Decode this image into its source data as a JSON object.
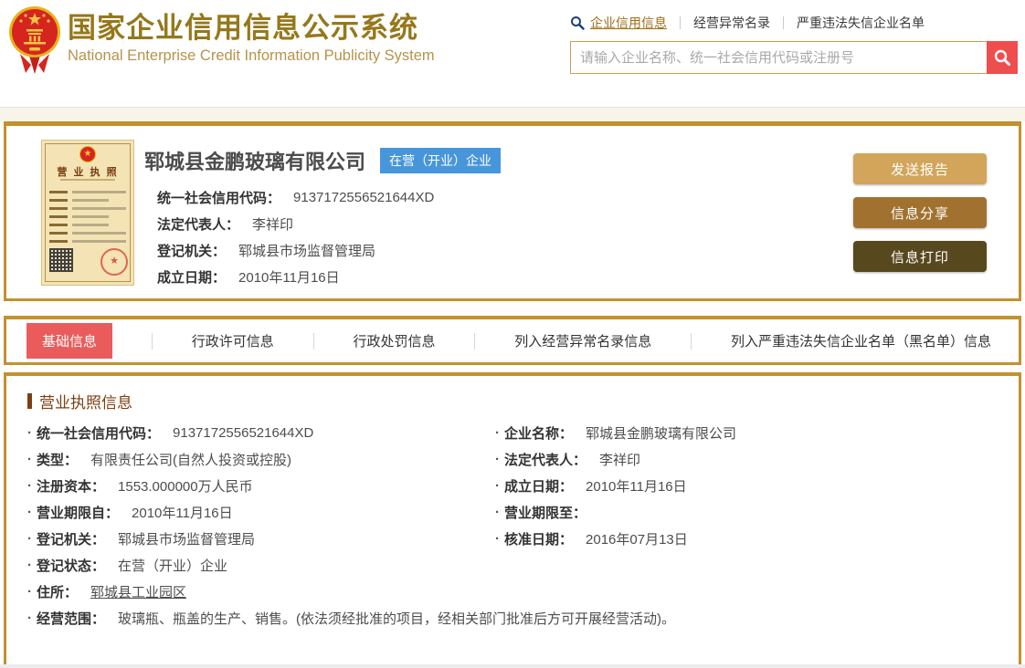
{
  "header": {
    "title_cn": "国家企业信用信息公示系统",
    "title_en": "National Enterprise Credit Information Publicity System",
    "nav": [
      {
        "label": "企业信用信息",
        "active": true
      },
      {
        "label": "经营异常名录",
        "active": false
      },
      {
        "label": "严重违法失信企业名单",
        "active": false
      }
    ],
    "search": {
      "placeholder": "请输入企业名称、统一社会信用代码或注册号",
      "button_icon": "search-icon"
    }
  },
  "company_card": {
    "license_thumbnail_title": "营 业 执 照",
    "name": "郓城县金鹏玻璃有限公司",
    "status_badge": "在营（开业）企业",
    "fields": [
      {
        "label": "统一社会信用代码：",
        "value": "9137172556521644XD"
      },
      {
        "label": "法定代表人：",
        "value": "李祥印"
      },
      {
        "label": "登记机关：",
        "value": "郓城县市场监督管理局"
      },
      {
        "label": "成立日期：",
        "value": "2010年11月16日"
      }
    ],
    "buttons": [
      {
        "label": "发送报告",
        "color": "#d2a55b"
      },
      {
        "label": "信息分享",
        "color": "#a1722f"
      },
      {
        "label": "信息打印",
        "color": "#57481d"
      }
    ]
  },
  "tabs": [
    {
      "label": "基础信息",
      "active": true
    },
    {
      "label": "行政许可信息",
      "active": false
    },
    {
      "label": "行政处罚信息",
      "active": false
    },
    {
      "label": "列入经营异常名录信息",
      "active": false
    },
    {
      "label": "列入严重违法失信企业名单（黑名单）信息",
      "active": false
    }
  ],
  "license_info": {
    "section_title": "营业执照信息",
    "rows": [
      {
        "left": {
          "label": "统一社会信用代码：",
          "value": "9137172556521644XD"
        },
        "right": {
          "label": "企业名称：",
          "value": "郓城县金鹏玻璃有限公司"
        }
      },
      {
        "left": {
          "label": "类型：",
          "value": "有限责任公司(自然人投资或控股)"
        },
        "right": {
          "label": "法定代表人：",
          "value": "李祥印"
        }
      },
      {
        "left": {
          "label": "注册资本：",
          "value": "1553.000000万人民币"
        },
        "right": {
          "label": "成立日期：",
          "value": "2010年11月16日"
        }
      },
      {
        "left": {
          "label": "营业期限自：",
          "value": "2010年11月16日"
        },
        "right": {
          "label": "营业期限至：",
          "value": ""
        }
      },
      {
        "left": {
          "label": "登记机关：",
          "value": "郓城县市场监督管理局"
        },
        "right": {
          "label": "核准日期：",
          "value": "2016年07月13日"
        }
      },
      {
        "left": {
          "label": "登记状态：",
          "value": "在营（开业）企业"
        },
        "right": null
      },
      {
        "left": {
          "label": "住所：",
          "value": "郓城县工业园区"
        },
        "right": null
      },
      {
        "full": {
          "label": "经营范围：",
          "value": "玻璃瓶、瓶盖的生产、销售。(依法须经批准的项目，经相关部门批准后方可开展经营活动)。"
        }
      }
    ]
  },
  "colors": {
    "gold_border": "#c3912e",
    "title_gold": "#96781b",
    "subtitle_gold": "#b6934a",
    "active_tab_red": "#ea5c5c",
    "search_button_red": "#ee4e4e",
    "status_badge_blue": "#4796dc",
    "section_brown": "#7d3f10",
    "cream_band": "#f8f4ea"
  }
}
